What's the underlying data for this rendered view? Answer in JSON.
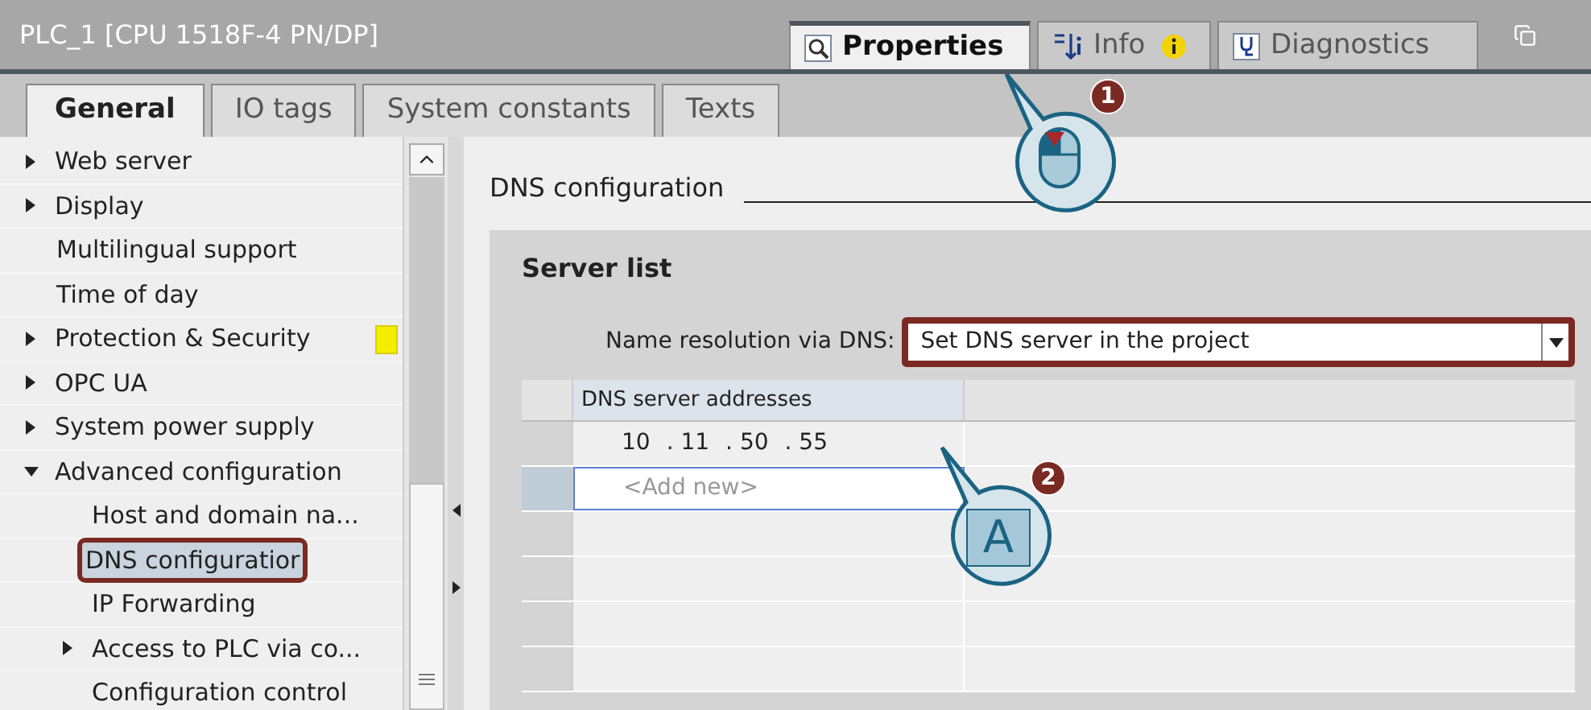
{
  "window": {
    "title": "PLC_1 [CPU 1518F-4 PN/DP]"
  },
  "inspector_tabs": [
    {
      "label": "Properties",
      "selected": true,
      "kind": "properties"
    },
    {
      "label": "Info",
      "selected": false,
      "kind": "info"
    },
    {
      "label": "Diagnostics",
      "selected": false,
      "kind": "diagnostics"
    }
  ],
  "tabs": [
    {
      "label": "General",
      "selected": true
    },
    {
      "label": "IO tags",
      "selected": false
    },
    {
      "label": "System constants",
      "selected": false
    },
    {
      "label": "Texts",
      "selected": false
    }
  ],
  "tree": [
    {
      "label": "Web server",
      "expanded": false,
      "has_children": true,
      "selected": false,
      "marked": false
    },
    {
      "label": "Display",
      "expanded": false,
      "has_children": true,
      "selected": false,
      "marked": false
    },
    {
      "label": "Multilingual support",
      "has_children": false,
      "selected": false,
      "marked": false
    },
    {
      "label": "Time of day",
      "has_children": false,
      "selected": false,
      "marked": false
    },
    {
      "label": "Protection & Security",
      "expanded": false,
      "has_children": true,
      "selected": false,
      "marked": true
    },
    {
      "label": "OPC UA",
      "expanded": false,
      "has_children": true,
      "selected": false,
      "marked": false
    },
    {
      "label": "System power supply",
      "expanded": false,
      "has_children": true,
      "selected": false,
      "marked": false
    },
    {
      "label": "Advanced configuration",
      "expanded": true,
      "has_children": true,
      "selected": false,
      "marked": false,
      "children": [
        {
          "label": "Host and domain na...",
          "has_children": false,
          "selected": false,
          "marked": false
        },
        {
          "label": "DNS configuratior",
          "has_children": false,
          "selected": true,
          "marked": false
        },
        {
          "label": "IP Forwarding",
          "has_children": false,
          "selected": false,
          "marked": false
        },
        {
          "label": "Access to PLC via co...",
          "expanded": false,
          "has_children": true,
          "selected": false,
          "marked": false
        },
        {
          "label": "Configuration control",
          "has_children": false,
          "selected": false,
          "marked": false
        }
      ]
    }
  ],
  "section": {
    "title": "DNS configuration",
    "group_title": "Server list",
    "name_resolution": {
      "label": "Name resolution via DNS:",
      "value": "Set DNS server in the project"
    },
    "table": {
      "columns": [
        "DNS server addresses"
      ],
      "rows": [
        {
          "octets": [
            "10",
            ". 11",
            ". 50",
            ". 55"
          ]
        }
      ],
      "new_row": {
        "placeholder": "<Add new>"
      }
    }
  },
  "callouts": [
    {
      "badge": "1",
      "kind": "mouse"
    },
    {
      "badge": "2",
      "kind": "text",
      "glyph": "A"
    }
  ]
}
